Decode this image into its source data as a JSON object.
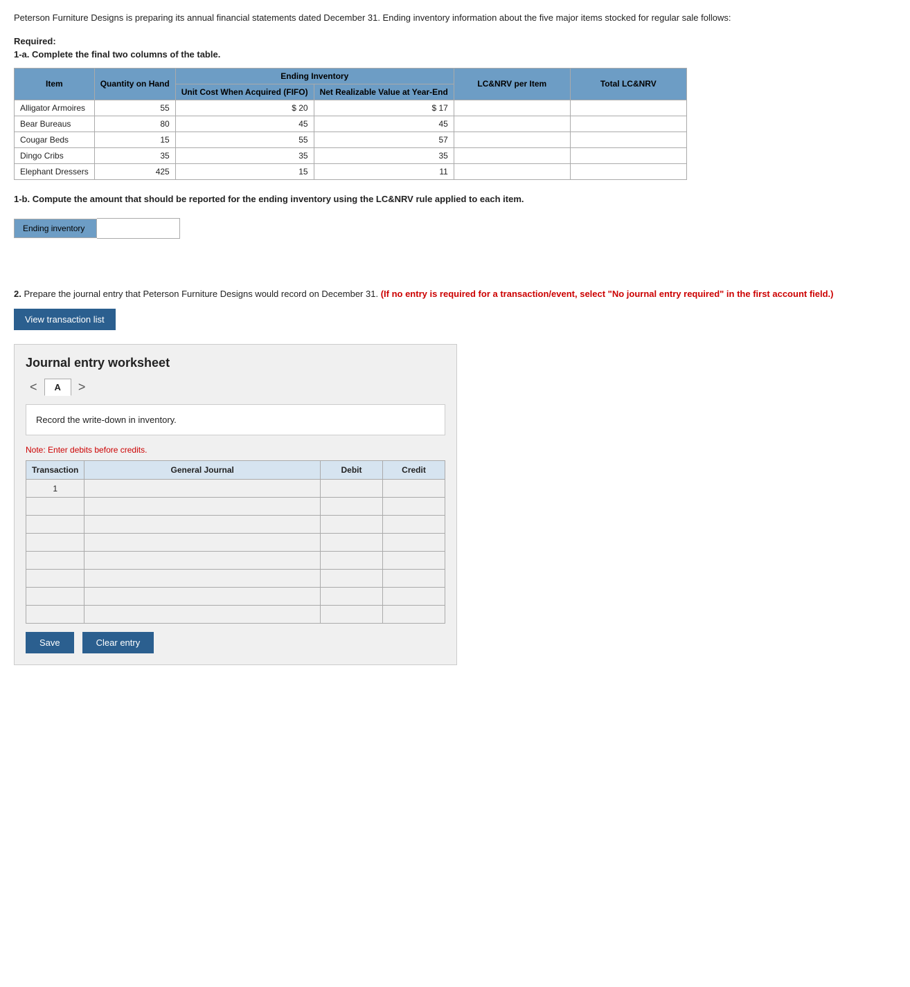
{
  "intro": {
    "text": "Peterson Furniture Designs is preparing its annual financial statements dated December 31. Ending inventory information about the five major items stocked for regular sale follows:"
  },
  "required": {
    "label": "Required:",
    "part_a_label": "1-a.",
    "part_a_text": "Complete the final two columns of the table."
  },
  "table": {
    "headers": {
      "ending_inventory": "Ending Inventory",
      "item": "Item",
      "quantity": "Quantity on Hand",
      "unit_cost": "Unit Cost When Acquired (FIFO)",
      "net_realizable": "Net Realizable Value at Year-End",
      "lc_nrv_per_item": "LC&NRV per Item",
      "total_lc_nrv": "Total LC&NRV"
    },
    "rows": [
      {
        "item": "Alligator Armoires",
        "quantity": "55",
        "unit_cost": "$ 20",
        "net_realizable": "$ 17",
        "lc_nrv_per_item": "",
        "total_lc_nrv": ""
      },
      {
        "item": "Bear Bureaus",
        "quantity": "80",
        "unit_cost": "45",
        "net_realizable": "45",
        "lc_nrv_per_item": "",
        "total_lc_nrv": ""
      },
      {
        "item": "Cougar Beds",
        "quantity": "15",
        "unit_cost": "55",
        "net_realizable": "57",
        "lc_nrv_per_item": "",
        "total_lc_nrv": ""
      },
      {
        "item": "Dingo Cribs",
        "quantity": "35",
        "unit_cost": "35",
        "net_realizable": "35",
        "lc_nrv_per_item": "",
        "total_lc_nrv": ""
      },
      {
        "item": "Elephant Dressers",
        "quantity": "425",
        "unit_cost": "15",
        "net_realizable": "11",
        "lc_nrv_per_item": "",
        "total_lc_nrv": ""
      }
    ]
  },
  "part_b": {
    "label": "1-b.",
    "text": "Compute the amount that should be reported for the ending inventory using the LC&NRV rule applied to each item.",
    "ending_inventory_label": "Ending inventory",
    "ending_inventory_value": ""
  },
  "part2": {
    "label": "2.",
    "text": "Prepare the journal entry that Peterson Furniture Designs would record on December 31.",
    "red_text": "(If no entry is required for a transaction/event, select \"No journal entry required\" in the first account field.)",
    "view_btn": "View transaction list"
  },
  "journal": {
    "title": "Journal entry worksheet",
    "tab": "A",
    "prev_arrow": "<",
    "next_arrow": ">",
    "instruction": "Record the write-down in inventory.",
    "note": "Note: Enter debits before credits.",
    "columns": {
      "transaction": "Transaction",
      "general_journal": "General Journal",
      "debit": "Debit",
      "credit": "Credit"
    },
    "rows": [
      {
        "transaction": "1",
        "general_journal": "",
        "debit": "",
        "credit": ""
      },
      {
        "transaction": "",
        "general_journal": "",
        "debit": "",
        "credit": ""
      },
      {
        "transaction": "",
        "general_journal": "",
        "debit": "",
        "credit": ""
      },
      {
        "transaction": "",
        "general_journal": "",
        "debit": "",
        "credit": ""
      },
      {
        "transaction": "",
        "general_journal": "",
        "debit": "",
        "credit": ""
      },
      {
        "transaction": "",
        "general_journal": "",
        "debit": "",
        "credit": ""
      },
      {
        "transaction": "",
        "general_journal": "",
        "debit": "",
        "credit": ""
      },
      {
        "transaction": "",
        "general_journal": "",
        "debit": "",
        "credit": ""
      }
    ],
    "save_btn": "Save",
    "clear_btn": "Clear entry"
  },
  "colors": {
    "header_bg": "#6d9dc5",
    "btn_bg": "#2b5f8f",
    "table_header_journal": "#d6e4f0"
  }
}
